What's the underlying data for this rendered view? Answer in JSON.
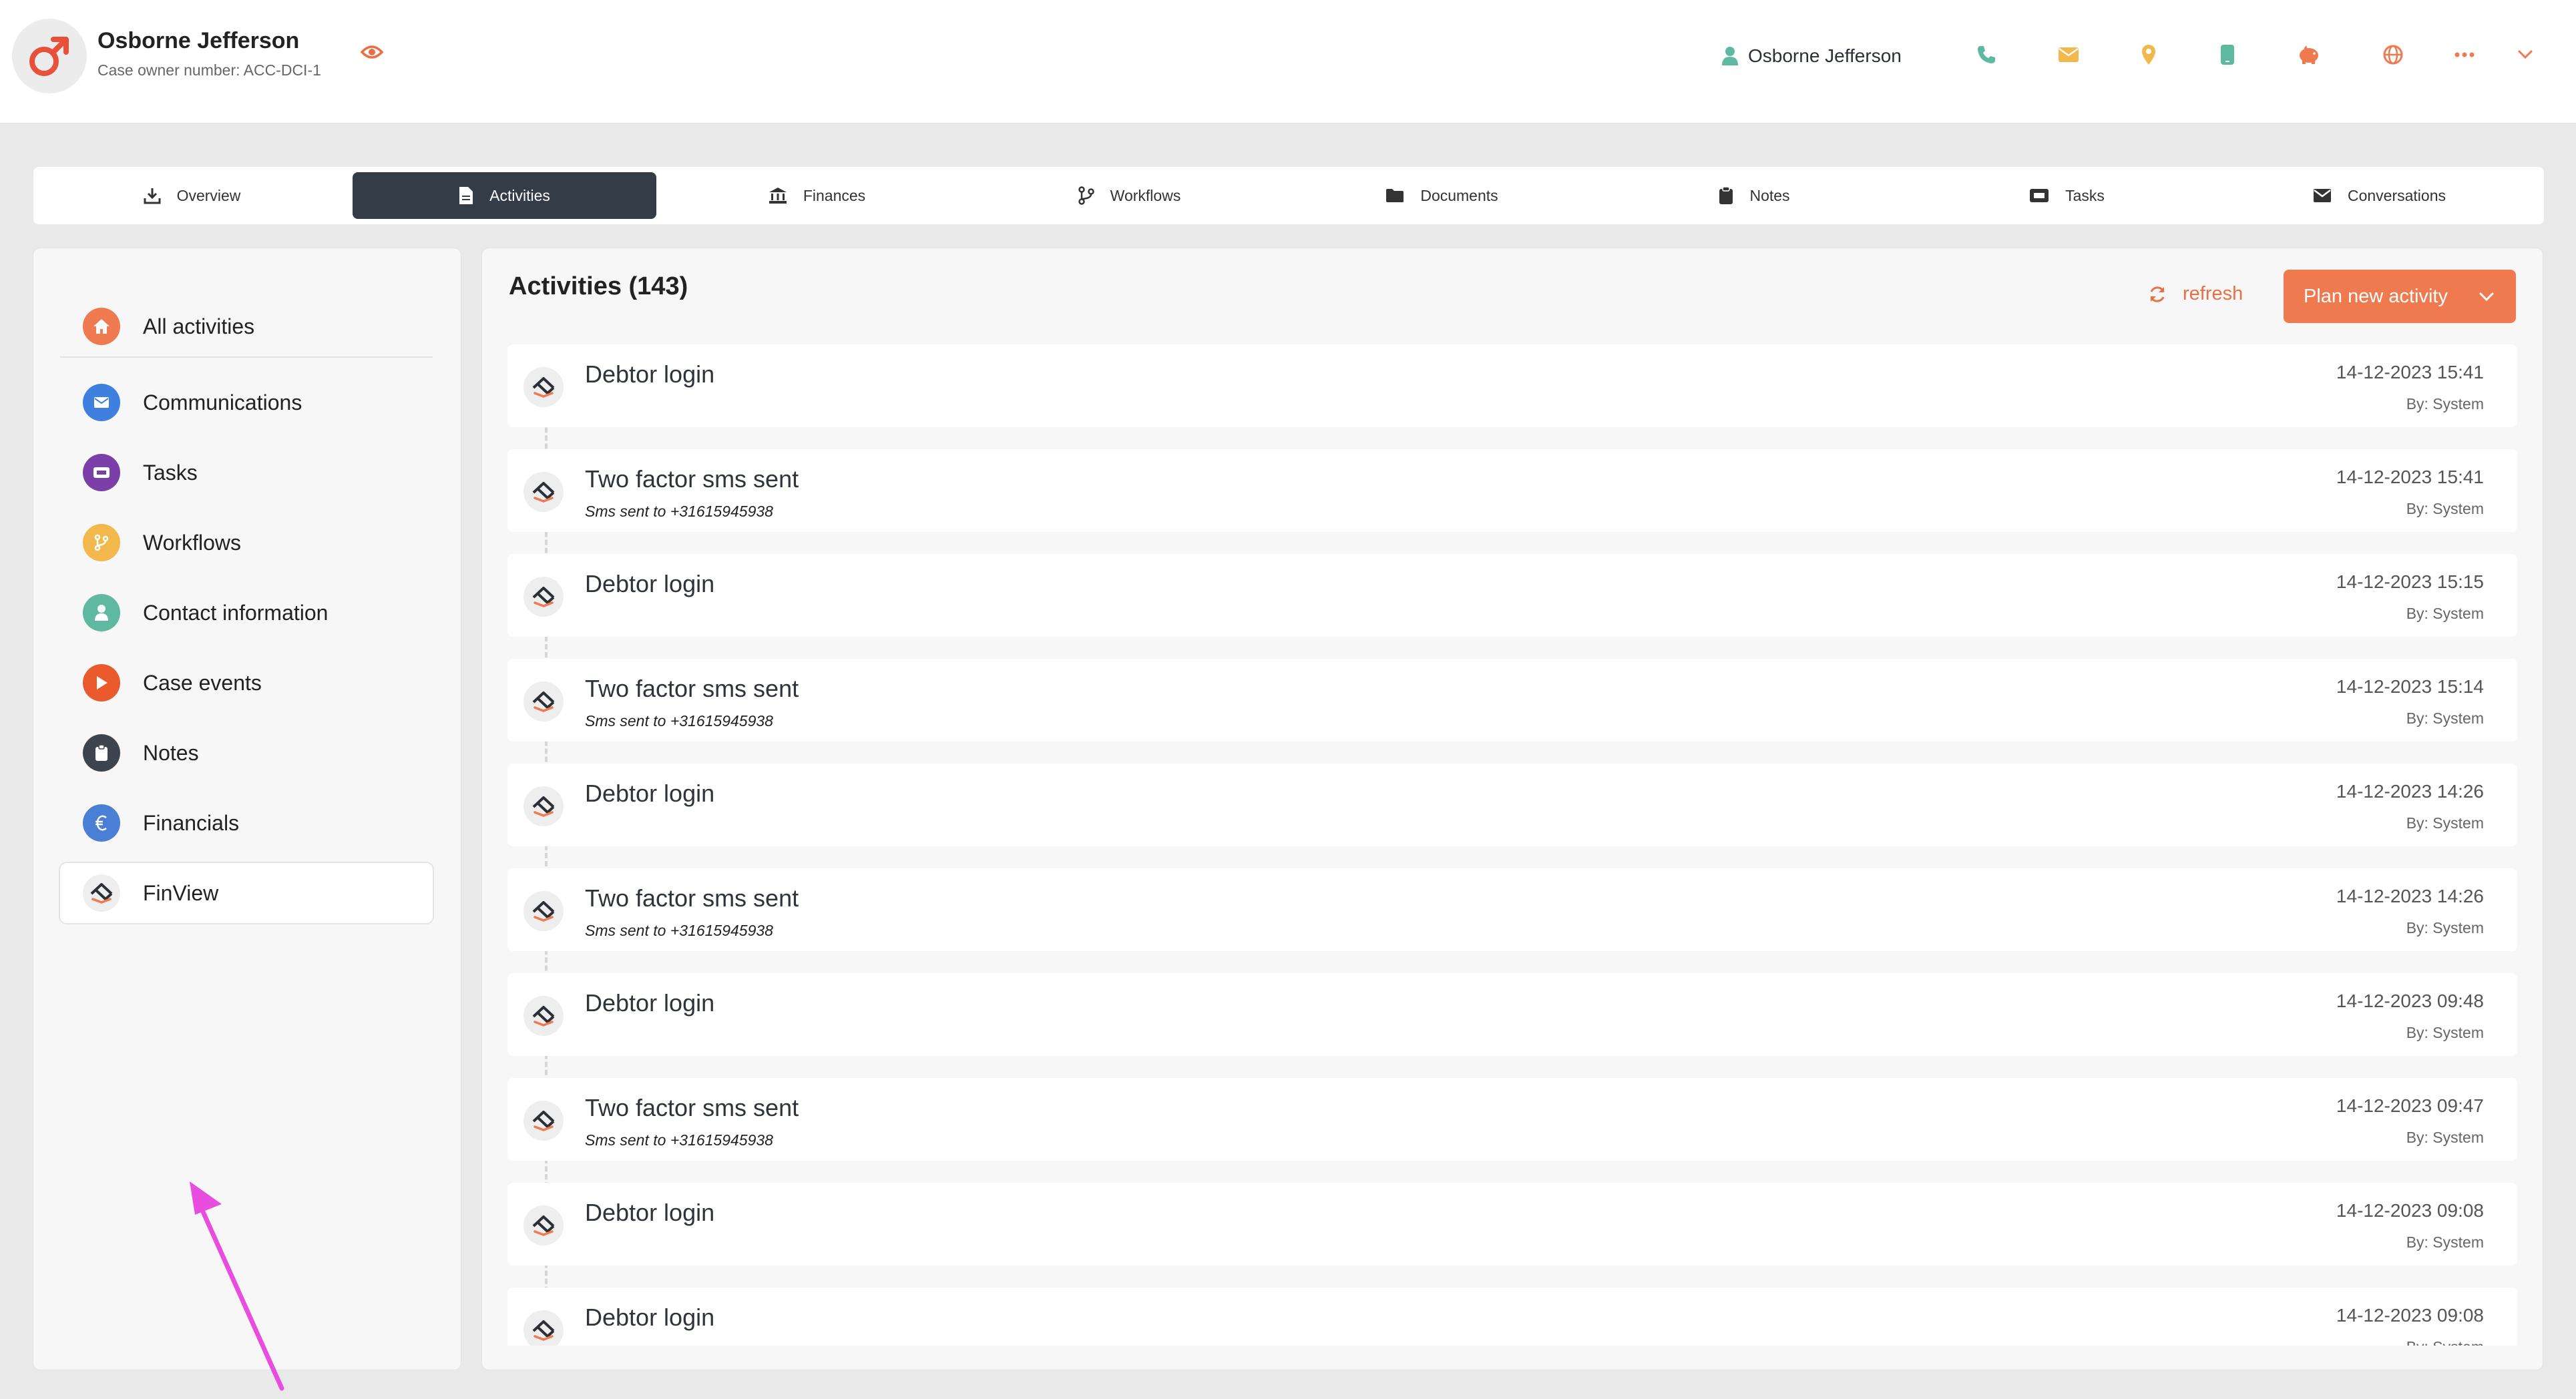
{
  "header": {
    "name": "Osborne Jefferson",
    "case_owner": "Case owner number: ACC-DCI-1",
    "user_name": "Osborne Jefferson",
    "icons": [
      "phone-icon",
      "mail-icon",
      "location-icon",
      "mobile-icon",
      "piggy-bank-icon",
      "globe-icon",
      "more-icon",
      "chevron-down-icon"
    ]
  },
  "tabs": [
    {
      "label": "Overview",
      "icon": "download-icon",
      "active": false
    },
    {
      "label": "Activities",
      "icon": "document-icon",
      "active": true
    },
    {
      "label": "Finances",
      "icon": "bank-icon",
      "active": false
    },
    {
      "label": "Workflows",
      "icon": "branch-icon",
      "active": false
    },
    {
      "label": "Documents",
      "icon": "folder-icon",
      "active": false
    },
    {
      "label": "Notes",
      "icon": "clipboard-icon",
      "active": false
    },
    {
      "label": "Tasks",
      "icon": "ticket-icon",
      "active": false
    },
    {
      "label": "Conversations",
      "icon": "envelope-icon",
      "active": false
    }
  ],
  "sidebar": {
    "items": [
      {
        "label": "All activities",
        "color": "#ef7a4f",
        "icon": "home-icon"
      },
      {
        "label": "Communications",
        "color": "#3f7fe0",
        "icon": "envelope-icon"
      },
      {
        "label": "Tasks",
        "color": "#7b3fa8",
        "icon": "ticket-icon"
      },
      {
        "label": "Workflows",
        "color": "#f2b84b",
        "icon": "branch-icon"
      },
      {
        "label": "Contact information",
        "color": "#5fb8a0",
        "icon": "user-icon"
      },
      {
        "label": "Case events",
        "color": "#ea5a2d",
        "icon": "play-icon"
      },
      {
        "label": "Notes",
        "color": "#3d4450",
        "icon": "clipboard-icon"
      },
      {
        "label": "Financials",
        "color": "#4a7fd6",
        "icon": "euro-icon"
      },
      {
        "label": "FinView",
        "color": "#eeeeee",
        "icon": "finview-logo-icon",
        "selected": true
      }
    ]
  },
  "main": {
    "title": "Activities (143)",
    "refresh_label": "refresh",
    "plan_label": "Plan new activity",
    "activities": [
      {
        "title": "Debtor login",
        "sub": "",
        "date": "14-12-2023 15:41",
        "by": "By: System"
      },
      {
        "title": "Two factor sms sent",
        "sub": "Sms sent to +31615945938",
        "date": "14-12-2023 15:41",
        "by": "By: System"
      },
      {
        "title": "Debtor login",
        "sub": "",
        "date": "14-12-2023 15:15",
        "by": "By: System"
      },
      {
        "title": "Two factor sms sent",
        "sub": "Sms sent to +31615945938",
        "date": "14-12-2023 15:14",
        "by": "By: System"
      },
      {
        "title": "Debtor login",
        "sub": "",
        "date": "14-12-2023 14:26",
        "by": "By: System"
      },
      {
        "title": "Two factor sms sent",
        "sub": "Sms sent to +31615945938",
        "date": "14-12-2023 14:26",
        "by": "By: System"
      },
      {
        "title": "Debtor login",
        "sub": "",
        "date": "14-12-2023 09:48",
        "by": "By: System"
      },
      {
        "title": "Two factor sms sent",
        "sub": "Sms sent to +31615945938",
        "date": "14-12-2023 09:47",
        "by": "By: System"
      },
      {
        "title": "Debtor login",
        "sub": "",
        "date": "14-12-2023 09:08",
        "by": "By: System"
      },
      {
        "title": "Debtor login",
        "sub": "",
        "date": "14-12-2023 09:08",
        "by": "By: System"
      }
    ]
  },
  "colors": {
    "accent": "#ef7a4f",
    "tab_active": "#343c47",
    "arrow": "#e84de0"
  }
}
